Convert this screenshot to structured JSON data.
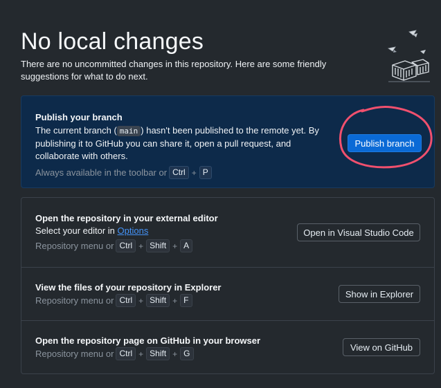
{
  "header": {
    "title": "No local changes",
    "subtitle": "There are no uncommitted changes in this repository. Here are some friendly suggestions for what to do next."
  },
  "publish": {
    "title": "Publish your branch",
    "desc_before": "The current branch (",
    "branch_name": "main",
    "desc_after": ") hasn't been published to the remote yet. By publishing it to GitHub you can share it, open a pull request, and collaborate with others.",
    "shortcut_prefix": "Always available in the toolbar or",
    "keys": [
      "Ctrl",
      "P"
    ],
    "button_label": "Publish branch",
    "annotation_color": "#f0506e"
  },
  "actions": [
    {
      "title": "Open the repository in your external editor",
      "desc_prefix": "Select your editor in",
      "desc_link": "Options",
      "shortcut_prefix": "Repository menu or",
      "keys": [
        "Ctrl",
        "Shift",
        "A"
      ],
      "button_label": "Open in Visual Studio Code"
    },
    {
      "title": "View the files of your repository in Explorer",
      "shortcut_prefix": "Repository menu or",
      "keys": [
        "Ctrl",
        "Shift",
        "F"
      ],
      "button_label": "Show in Explorer"
    },
    {
      "title": "Open the repository page on GitHub in your browser",
      "shortcut_prefix": "Repository menu or",
      "keys": [
        "Ctrl",
        "Shift",
        "G"
      ],
      "button_label": "View on GitHub"
    }
  ],
  "keys_plus": "+",
  "colors": {
    "background": "#24292e",
    "publish_card": "#0d2a4a",
    "primary_button": "#0a6ad6",
    "link": "#4493f8"
  }
}
